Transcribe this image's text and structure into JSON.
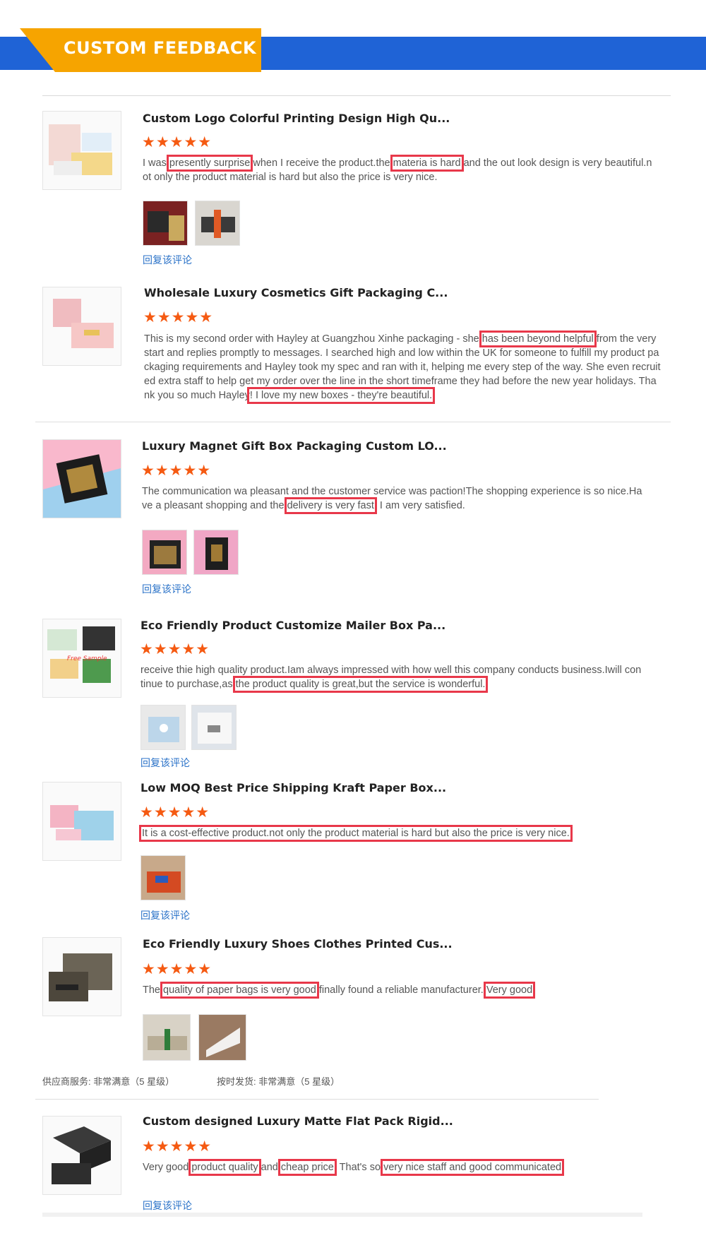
{
  "header": {
    "title": "CUSTOM FEEDBACK",
    "colors": {
      "band": "#1f63d6",
      "tab": "#f6a400"
    }
  },
  "stars_glyph": "★★★★★",
  "reply_link": "回复该评论",
  "reviews": [
    {
      "title": "Custom Logo Colorful Printing Design High Qu...",
      "pre1": "I was ",
      "hl1": "presently surprise",
      "mid1": " when I receive the product.the ",
      "hl2": "materia is hard",
      "post": " and the out look design is very beautiful.not only the product material is hard but also the price is very nice."
    },
    {
      "title": "Wholesale Luxury Cosmetics Gift Packaging C...",
      "pre1": "This is my second order with Hayley at Guangzhou Xinhe packaging - she ",
      "hl1": "has been beyond helpful",
      "mid1": " from the very start and replies promptly to messages. I searched high and low within the UK for someone to fulfill my product packaging requirements and Hayley took my spec and ran with it, helping me every step of the way. She even recruited extra staff to help get my order over the line in the short timeframe they had before the new year holidays. Thank you so much Hayley",
      "hl2": "! I love my new boxes - they're beautiful."
    },
    {
      "title": "Luxury Magnet Gift Box Packaging Custom LO...",
      "pre1": "The communication wa pleasant and the customer service was paction!The shopping experience is so nice.Have a pleasant shopping and the ",
      "hl1": "delivery is very fast",
      "post": ". I am very satisfied."
    },
    {
      "title": "Eco Friendly Product Customize Mailer Box Pa...",
      "pre1": "receive thie high quality product.Iam always impressed with how well this company conducts business.Iwill continue to purchase,as ",
      "hl1": "the product quality is great,but the service is wonderful."
    },
    {
      "title": "Low MOQ Best Price Shipping Kraft Paper Box...",
      "hl1": "It is a cost-effective product.not only the product material is hard but also the price is very nice."
    },
    {
      "title": "Eco Friendly Luxury Shoes Clothes Printed Cus...",
      "pre1": "The ",
      "hl1": "quality of paper bags is very good",
      "mid1": ",finally found a reliable manufacturer. ",
      "hl2": "Very good"
    },
    {
      "title": "Custom designed Luxury Matte Flat Pack Rigid...",
      "pre1": "Very good ",
      "hl1": "product quality",
      "mid1": " and ",
      "hl2": "cheap price",
      "mid2": ". That's so ",
      "hl3": "very nice staff and good communicated"
    }
  ],
  "supplier_meta": {
    "service": "供应商服务: 非常满意（5 星级）",
    "shipping": "按时发货: 非常满意（5 星级）"
  }
}
